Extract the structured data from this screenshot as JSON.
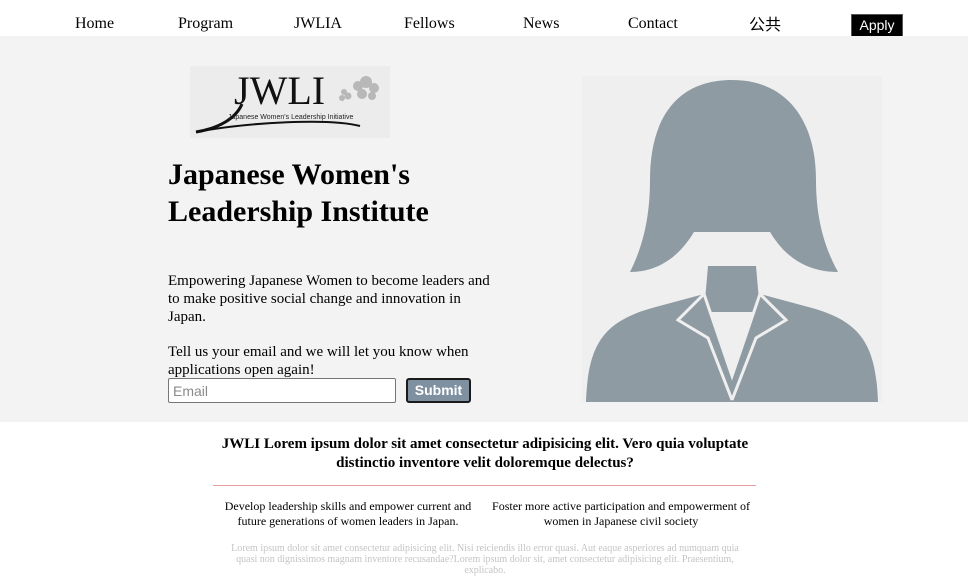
{
  "nav": {
    "items": [
      {
        "label": "Home"
      },
      {
        "label": "Program"
      },
      {
        "label": "JWLIA"
      },
      {
        "label": "Fellows"
      },
      {
        "label": "News"
      },
      {
        "label": "Contact"
      },
      {
        "label": "公共"
      }
    ],
    "apply_label": "Apply"
  },
  "hero": {
    "logo_text": "JWLI",
    "logo_subtitle": "Japanese Women's Leadership Initiative",
    "title": "Japanese Women's Leadership Institute",
    "description": "Empowering Japanese Women to become leaders and to make positive social change and innovation in Japan.",
    "cta": "Tell us your email and we will let you know when applications open again!",
    "email_placeholder": "Email",
    "submit_label": "Submit"
  },
  "about": {
    "lead": "JWLI Lorem ipsum dolor sit amet consectetur adipisicing elit. Vero quia voluptate distinctio inventore velit doloremque delectus?",
    "columns": [
      {
        "text": "Develop leadership skills and empower current and future generations of women leaders in Japan."
      },
      {
        "text": "Foster more active participation and empowerment of women in Japanese civil society"
      }
    ],
    "fineprint": "Lorem ipsum dolor sit amet consectetur adipisicing elit. Nisi reiciendis illo error quasi. Aut eaque asperiores ad numquam quia quasi non dignissimos magnam inventore recusandae?Lorem ipsum dolor sit, amet consectetur adipisicing elit. Praesentium, explicabo."
  },
  "colors": {
    "hero_bg": "#f3f3f3",
    "silhouette": "#8f9ba3",
    "submit_bg": "#7f90a1",
    "divider": "#e6a0a0",
    "fineprint": "#c4c4c4"
  }
}
